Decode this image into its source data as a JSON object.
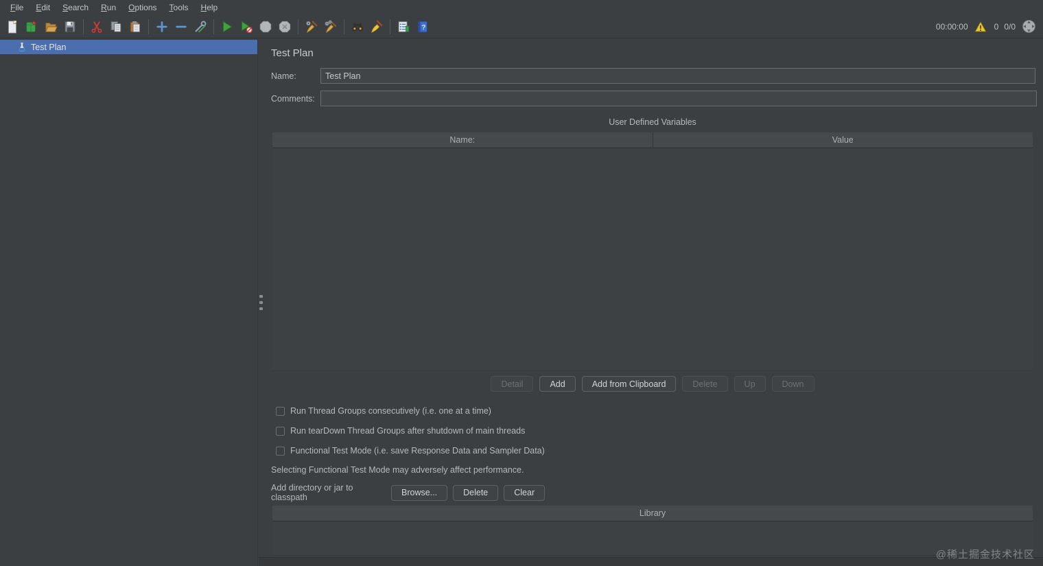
{
  "menu": {
    "items": [
      "File",
      "Edit",
      "Search",
      "Run",
      "Options",
      "Tools",
      "Help"
    ]
  },
  "toolbar": {
    "icons": [
      "new-file-icon",
      "templates-icon",
      "open-icon",
      "save-icon",
      "cut-icon",
      "copy-icon",
      "paste-icon",
      "add-icon",
      "remove-icon",
      "toggle-icon",
      "start-icon",
      "start-no-timers-icon",
      "stop-icon",
      "shutdown-icon",
      "clear-icon",
      "clear-all-icon",
      "search-icon",
      "search-reset-icon",
      "function-helper-icon",
      "help-icon"
    ],
    "timer": "00:00:00",
    "error_count": "0",
    "thread_status": "0/0"
  },
  "tree": {
    "items": [
      {
        "label": "Test Plan",
        "selected": true
      }
    ]
  },
  "main": {
    "title": "Test Plan",
    "name_label": "Name:",
    "name_value": "Test Plan",
    "comments_label": "Comments:",
    "comments_value": "",
    "udv": {
      "title": "User Defined Variables",
      "columns": [
        "Name:",
        "Value"
      ],
      "rows": []
    },
    "table_buttons": [
      {
        "label": "Detail",
        "enabled": false
      },
      {
        "label": "Add",
        "enabled": true
      },
      {
        "label": "Add from Clipboard",
        "enabled": true
      },
      {
        "label": "Delete",
        "enabled": false
      },
      {
        "label": "Up",
        "enabled": false
      },
      {
        "label": "Down",
        "enabled": false
      }
    ],
    "checkboxes": [
      {
        "label": "Run Thread Groups consecutively (i.e. one at a time)",
        "checked": false
      },
      {
        "label": "Run tearDown Thread Groups after shutdown of main threads",
        "checked": false
      },
      {
        "label": "Functional Test Mode (i.e. save Response Data and Sampler Data)",
        "checked": false
      }
    ],
    "note": "Selecting Functional Test Mode may adversely affect performance.",
    "classpath": {
      "label": "Add directory or jar to classpath",
      "buttons": [
        "Browse...",
        "Delete",
        "Clear"
      ]
    },
    "library": {
      "header": "Library",
      "rows": []
    }
  },
  "watermark": "@稀土掘金技术社区",
  "colors": {
    "selection_blue": "#4b6eaf",
    "warning_yellow": "#e8c832",
    "start_green": "#3fa33f",
    "window_bg": "#3c3f41"
  }
}
